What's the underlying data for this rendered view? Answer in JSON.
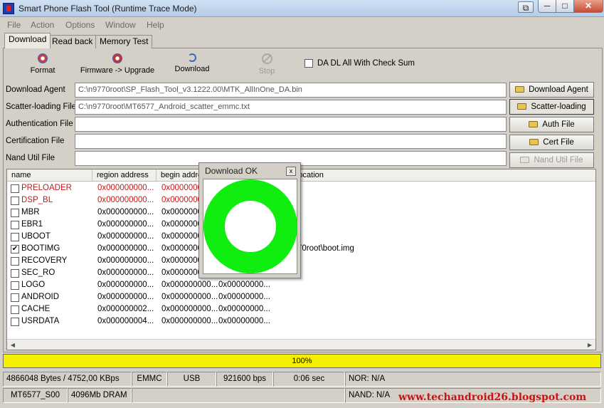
{
  "window": {
    "title": "Smart Phone Flash Tool (Runtime Trace Mode)",
    "min_glyph": "─",
    "max_glyph": "□",
    "close_glyph": "✕",
    "side_glyph": "⧉"
  },
  "menu": [
    "File",
    "Action",
    "Options",
    "Window",
    "Help"
  ],
  "tabs": [
    "Download",
    "Read back",
    "Memory Test"
  ],
  "toolbar": {
    "format": "Format",
    "firmware_upgrade": "Firmware -> Upgrade",
    "download": "Download",
    "stop": "Stop",
    "checksum_label": "DA DL All With Check Sum"
  },
  "files": {
    "download_agent": {
      "label": "Download Agent",
      "value": "C:\\n9770root\\SP_Flash_Tool_v3.1222.00\\MTK_AllInOne_DA.bin",
      "button": "Download Agent"
    },
    "scatter": {
      "label": "Scatter-loading File",
      "value": "C:\\n9770root\\MT6577_Android_scatter_emmc.txt",
      "button": "Scatter-loading"
    },
    "auth": {
      "label": "Authentication File",
      "value": "",
      "button": "Auth File"
    },
    "cert": {
      "label": "Certification File",
      "value": "",
      "button": "Cert File"
    },
    "nand": {
      "label": "Nand Util File",
      "value": "",
      "button": "Nand Util File"
    }
  },
  "list": {
    "columns": [
      "name",
      "region address",
      "begin address",
      "",
      "location"
    ],
    "rows": [
      {
        "name": "PRELOADER",
        "region": "0x000000000...",
        "begin": "0x0000000",
        "end": "",
        "location": "",
        "checked": false,
        "red": true
      },
      {
        "name": "DSP_BL",
        "region": "0x000000000...",
        "begin": "0x0000000",
        "end": "",
        "location": "",
        "checked": false,
        "red": true
      },
      {
        "name": "MBR",
        "region": "0x000000000...",
        "begin": "0x0000000",
        "end": "",
        "location": "",
        "checked": false,
        "red": false
      },
      {
        "name": "EBR1",
        "region": "0x000000000...",
        "begin": "0x0000000",
        "end": "",
        "location": "",
        "checked": false,
        "red": false
      },
      {
        "name": "UBOOT",
        "region": "0x000000000...",
        "begin": "0x0000000",
        "end": "",
        "location": "",
        "checked": false,
        "red": false
      },
      {
        "name": "BOOTIMG",
        "region": "0x000000000...",
        "begin": "0x0000000",
        "end": "",
        "location": "70root\\boot.img",
        "checked": true,
        "red": false
      },
      {
        "name": "RECOVERY",
        "region": "0x000000000...",
        "begin": "0x0000000",
        "end": "",
        "location": "",
        "checked": false,
        "red": false
      },
      {
        "name": "SEC_RO",
        "region": "0x000000000...",
        "begin": "0x0000000",
        "end": "",
        "location": "",
        "checked": false,
        "red": false
      },
      {
        "name": "LOGO",
        "region": "0x000000000...",
        "begin": "0x000000000...",
        "end": "0x00000000...",
        "location": "",
        "checked": false,
        "red": false
      },
      {
        "name": "ANDROID",
        "region": "0x000000000...",
        "begin": "0x000000000...",
        "end": "0x00000000...",
        "location": "",
        "checked": false,
        "red": false
      },
      {
        "name": "CACHE",
        "region": "0x000000002...",
        "begin": "0x000000000...",
        "end": "0x00000000...",
        "location": "",
        "checked": false,
        "red": false
      },
      {
        "name": "USRDATA",
        "region": "0x000000004...",
        "begin": "0x000000000...",
        "end": "0x00000000...",
        "location": "",
        "checked": false,
        "red": false
      }
    ]
  },
  "progress": {
    "text": "100%",
    "fraction": 1.0,
    "color": "#f5ef00"
  },
  "status": {
    "bytes": "4866048 Bytes / 4752,00 KBps",
    "storage": "EMMC",
    "port": "USB",
    "baud": "921600 bps",
    "time": "0:06 sec",
    "nor": "NOR: N/A",
    "chip": "MT6577_S00",
    "dram": "4096Mb DRAM",
    "nand": "NAND: N/A"
  },
  "watermark": "www.techandroid26.blogspot.com",
  "dialog": {
    "title": "Download OK",
    "close_glyph": "x",
    "ring_color": "#10ee10"
  },
  "colors": {
    "accent_red": "#c41818",
    "format_icon": "#d63a3a",
    "upgrade_icon": "#c0392b",
    "download_icon": "#3a66c4"
  }
}
